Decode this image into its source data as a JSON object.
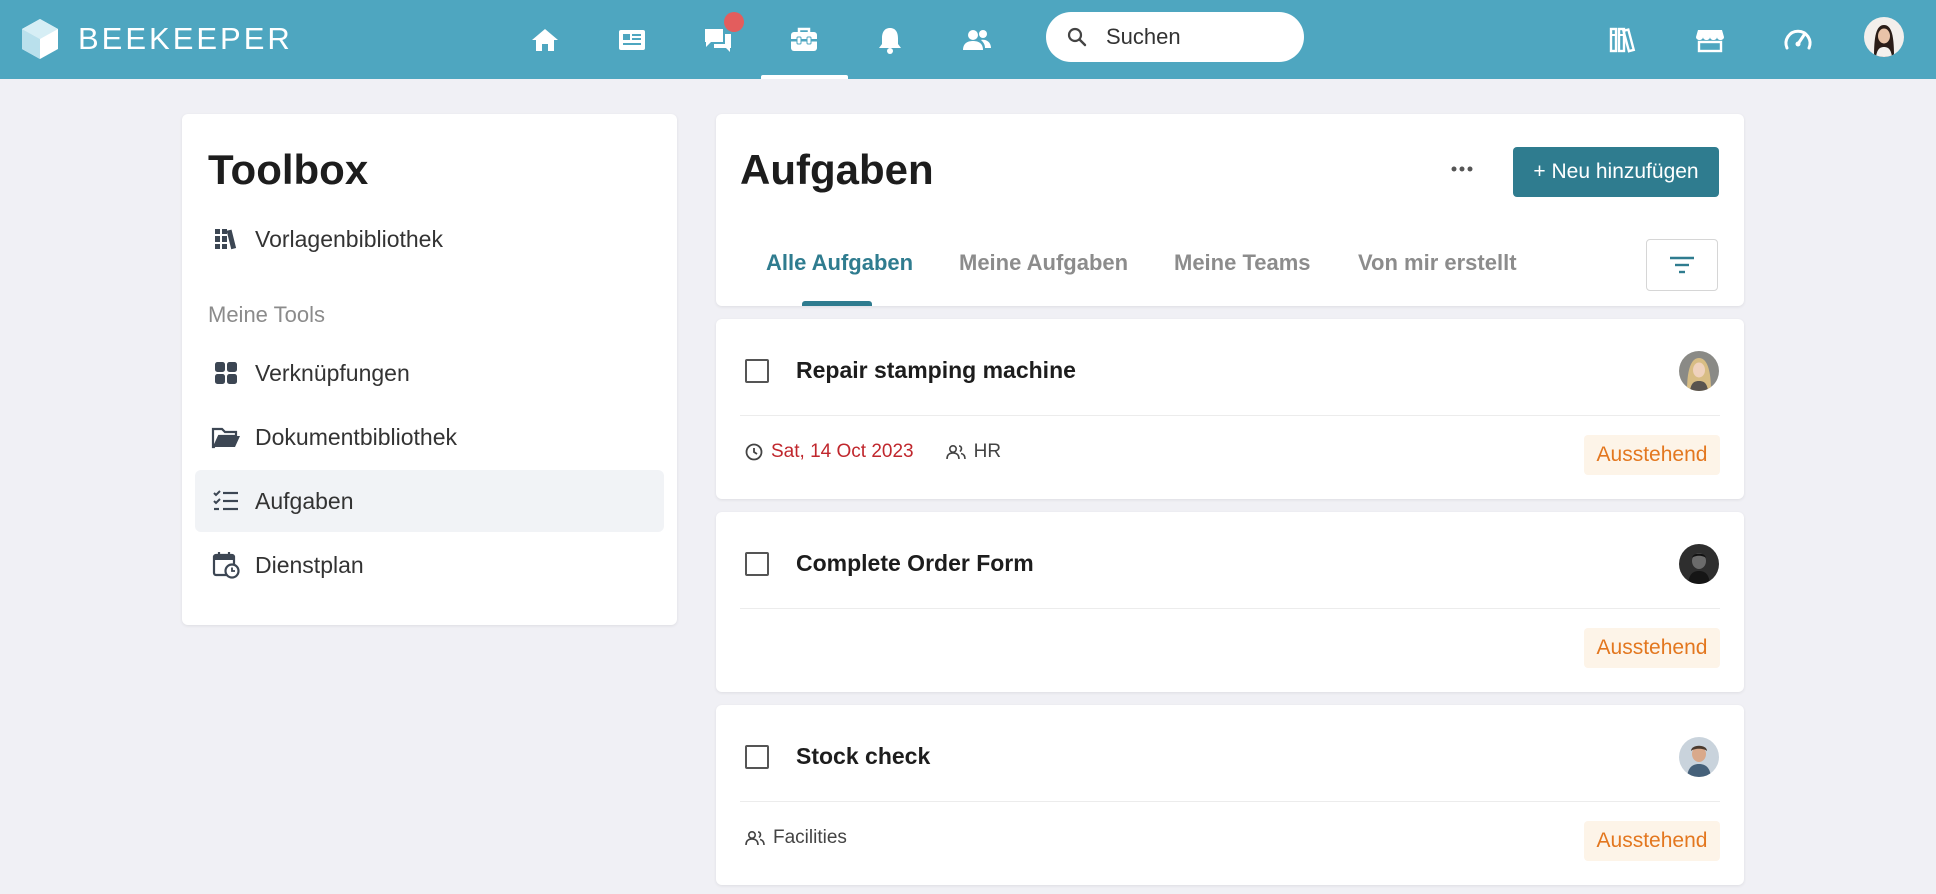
{
  "app": {
    "brand_name": "BEEKEEPER",
    "accent_color": "#4ea6c0",
    "primary_button_color": "#2f7c8f"
  },
  "topnav": {
    "items": [
      {
        "icon": "home-icon"
      },
      {
        "icon": "news-icon"
      },
      {
        "icon": "chat-icon",
        "has_unread_badge": true
      },
      {
        "icon": "toolbox-icon",
        "active": true
      },
      {
        "icon": "bell-icon"
      },
      {
        "icon": "people-icon"
      }
    ],
    "search_placeholder": "Suchen",
    "right_icons": [
      "library-icon",
      "store-icon",
      "dashboard-icon",
      "user-avatar"
    ]
  },
  "sidebar": {
    "title": "Toolbox",
    "top_item": {
      "label": "Vorlagenbibliothek",
      "icon": "books-icon"
    },
    "section_label": "Meine Tools",
    "items": [
      {
        "label": "Verknüpfungen",
        "icon": "grid-icon"
      },
      {
        "label": "Dokumentbibliothek",
        "icon": "folder-icon"
      },
      {
        "label": "Aufgaben",
        "icon": "checklist-icon",
        "active": true
      },
      {
        "label": "Dienstplan",
        "icon": "calendar-clock-icon"
      }
    ]
  },
  "main": {
    "title": "Aufgaben",
    "add_button_label": "+ Neu hinzufügen",
    "tabs": [
      {
        "label": "Alle Aufgaben",
        "active": true
      },
      {
        "label": "Meine Aufgaben"
      },
      {
        "label": "Meine Teams"
      },
      {
        "label": "Von mir erstellt"
      }
    ]
  },
  "tasks": [
    {
      "title": "Repair stamping machine",
      "due": "Sat, 14 Oct 2023",
      "team": "HR",
      "status": "Ausstehend"
    },
    {
      "title": "Complete Order Form",
      "due": "",
      "team": "",
      "status": "Ausstehend"
    },
    {
      "title": "Stock check",
      "due": "",
      "team": "Facilities",
      "status": "Ausstehend"
    }
  ]
}
